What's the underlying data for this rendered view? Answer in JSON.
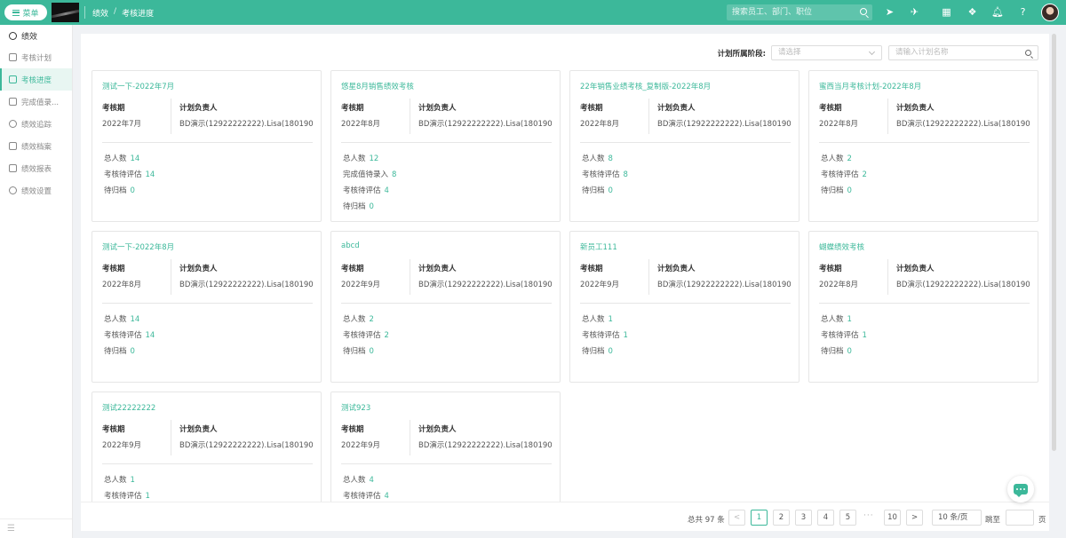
{
  "topbar": {
    "menu_label": "菜单",
    "breadcrumb": [
      "绩效",
      "考核进度"
    ],
    "breadcrumb_sep": "/",
    "search_placeholder": "搜索员工、部门、职位",
    "accent_color": "#3cb89a"
  },
  "sidebar": {
    "header": "绩效",
    "items": [
      {
        "label": "考核计划",
        "icon": "file-icon",
        "active": false
      },
      {
        "label": "考核进度",
        "icon": "document-icon",
        "active": true
      },
      {
        "label": "完成值录...",
        "icon": "pen-icon",
        "active": false
      },
      {
        "label": "绩效追踪",
        "icon": "target-icon",
        "active": false
      },
      {
        "label": "绩效档案",
        "icon": "archive-icon",
        "active": false
      },
      {
        "label": "绩效报表",
        "icon": "chart-icon",
        "active": false
      },
      {
        "label": "绩效设置",
        "icon": "settings-icon",
        "active": false
      }
    ],
    "footer": "☰"
  },
  "filter": {
    "label": "计划所属阶段:",
    "select_placeholder": "请选择",
    "input_placeholder": "请输入计划名称"
  },
  "card_labels": {
    "period": "考核期",
    "owner": "计划负责人"
  },
  "cards": [
    {
      "title": "测试一下-2022年7月",
      "period": "2022年7月",
      "owner": "BD演示(12922222222).Lisa(18019085...",
      "stats": [
        {
          "label": "总人数",
          "value": "14"
        },
        {
          "label": "考核待评估",
          "value": "14"
        },
        {
          "label": "待归档",
          "value": "0"
        }
      ]
    },
    {
      "title": "悠星8月销售绩效考核",
      "period": "2022年8月",
      "owner": "BD演示(12922222222).Lisa(18019085...",
      "stats": [
        {
          "label": "总人数",
          "value": "12"
        },
        {
          "label": "完成值待录入",
          "value": "8"
        },
        {
          "label": "考核待评估",
          "value": "4"
        },
        {
          "label": "待归档",
          "value": "0"
        }
      ]
    },
    {
      "title": "22年销售业绩考核_复制版-2022年8月",
      "period": "2022年8月",
      "owner": "BD演示(12922222222).Lisa(18019085...",
      "stats": [
        {
          "label": "总人数",
          "value": "8"
        },
        {
          "label": "考核待评估",
          "value": "8"
        },
        {
          "label": "待归档",
          "value": "0"
        }
      ]
    },
    {
      "title": "蜜西当月考核计划-2022年8月",
      "period": "2022年8月",
      "owner": "BD演示(12922222222).Lisa(18019085...",
      "stats": [
        {
          "label": "总人数",
          "value": "2"
        },
        {
          "label": "考核待评估",
          "value": "2"
        },
        {
          "label": "待归档",
          "value": "0"
        }
      ]
    },
    {
      "title": "测试一下-2022年8月",
      "period": "2022年8月",
      "owner": "BD演示(12922222222).Lisa(18019085...",
      "stats": [
        {
          "label": "总人数",
          "value": "14"
        },
        {
          "label": "考核待评估",
          "value": "14"
        },
        {
          "label": "待归档",
          "value": "0"
        }
      ]
    },
    {
      "title": "abcd",
      "period": "2022年9月",
      "owner": "BD演示(12922222222).Lisa(18019085...",
      "stats": [
        {
          "label": "总人数",
          "value": "2"
        },
        {
          "label": "考核待评估",
          "value": "2"
        },
        {
          "label": "待归档",
          "value": "0"
        }
      ]
    },
    {
      "title": "新员工111",
      "period": "2022年9月",
      "owner": "BD演示(12922222222).Lisa(18019085...",
      "stats": [
        {
          "label": "总人数",
          "value": "1"
        },
        {
          "label": "考核待评估",
          "value": "1"
        },
        {
          "label": "待归档",
          "value": "0"
        }
      ]
    },
    {
      "title": "蝴蝶绩效考核",
      "period": "2022年8月",
      "owner": "BD演示(12922222222).Lisa(18019085...",
      "stats": [
        {
          "label": "总人数",
          "value": "1"
        },
        {
          "label": "考核待评估",
          "value": "1"
        },
        {
          "label": "待归档",
          "value": "0"
        }
      ]
    },
    {
      "title": "测试22222222",
      "period": "2022年9月",
      "owner": "BD演示(12922222222).Lisa(18019085...",
      "stats": [
        {
          "label": "总人数",
          "value": "1"
        },
        {
          "label": "考核待评估",
          "value": "1"
        }
      ]
    },
    {
      "title": "测试923",
      "period": "2022年9月",
      "owner": "BD演示(12922222222).Lisa(18019085...",
      "stats": [
        {
          "label": "总人数",
          "value": "4"
        },
        {
          "label": "考核待评估",
          "value": "4"
        }
      ]
    }
  ],
  "pagination": {
    "total_text": "总共 97 条",
    "pages": [
      "1",
      "2",
      "3",
      "4",
      "5"
    ],
    "ellipsis": "···",
    "last_page": "10",
    "current": "1",
    "page_size": "10 条/页",
    "jump_label": "跳至",
    "page_suffix": "页",
    "prev": "<",
    "next": ">"
  }
}
